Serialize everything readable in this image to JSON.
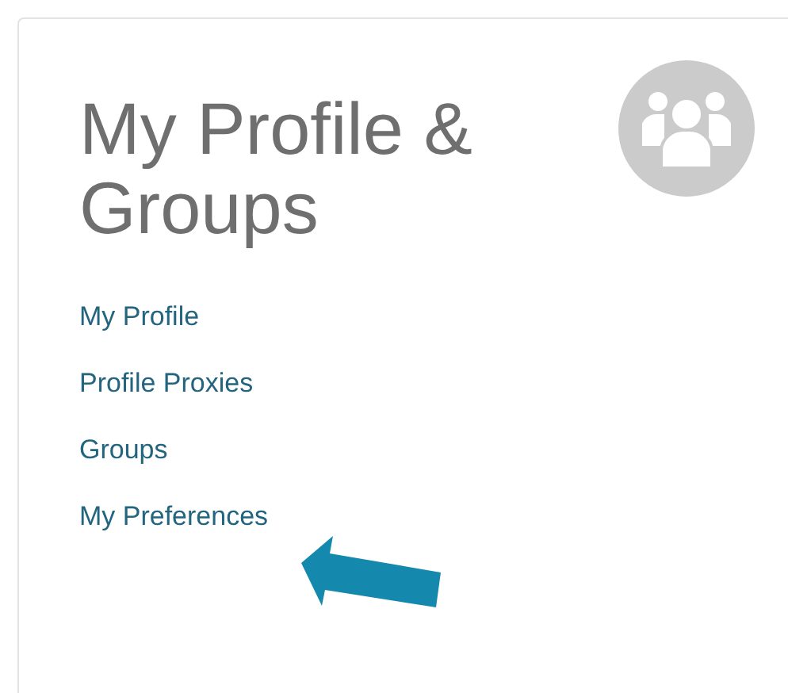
{
  "title": "My Profile & Groups",
  "links": [
    "My Profile",
    "Profile Proxies",
    "Groups",
    "My Preferences"
  ]
}
